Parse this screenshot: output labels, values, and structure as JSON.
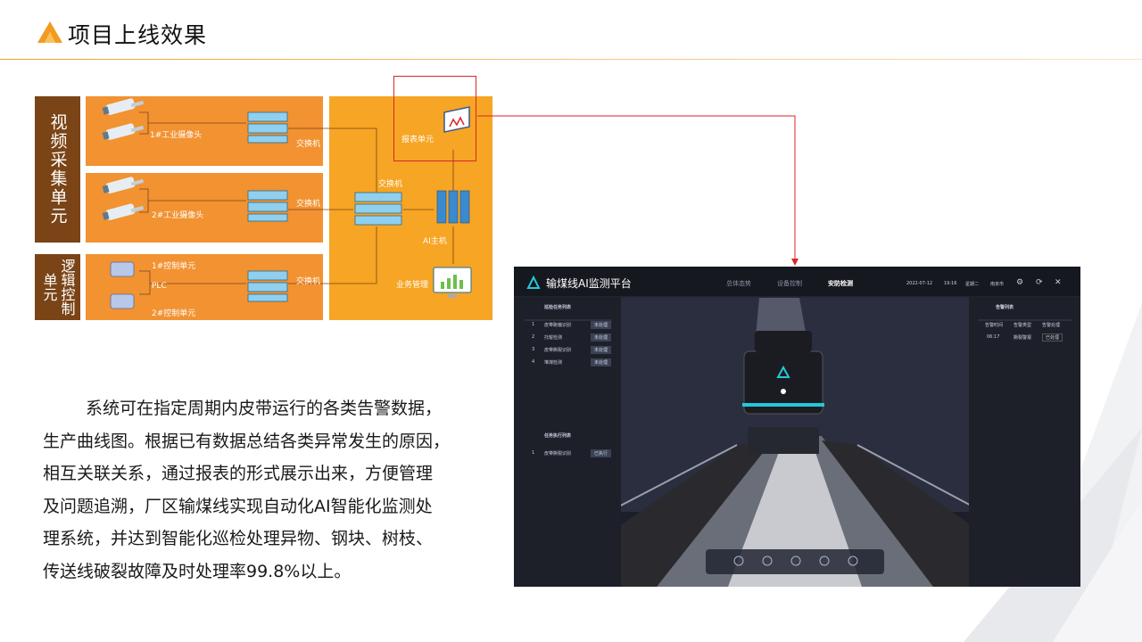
{
  "header": {
    "title": "项目上线效果"
  },
  "diagram": {
    "video_unit": "视频采集单元",
    "logic_unit": "逻辑控制单元",
    "camera1": "1#工业摄像头",
    "camera2": "2#工业摄像头",
    "switch1": "交换机",
    "switch2": "交换机",
    "switch3": "交换机",
    "switch_center": "交换机",
    "ai_host": "AI主机",
    "report_unit": "报表单元",
    "business": "业务管理",
    "ctrl1": "1#控制单元",
    "plc": "PLC",
    "ctrl2": "2#控制单元"
  },
  "body": {
    "line1": "系统可在指定周期内皮带运行的各类告警数据，",
    "line2": "生产曲线图。根据已有数据总结各类异常发生的原因，",
    "line3": "相互关联关系，通过报表的形式展示出来，方便管理",
    "line4": "及问题追溯，厂区输煤线实现自动化AI智能化监测处",
    "line5": "理系统，并达到智能化巡检处理异物、钢块、树枝、",
    "line6": "传送线破裂故障及时处理率99.8%以上。"
  },
  "platform": {
    "title": "输煤线AI监测平台",
    "tab1": "总体态势",
    "tab2": "设备控制",
    "tab3": "安防检测",
    "date": "2022-07-12",
    "time": "19:16",
    "weekday": "星期二",
    "location": "南京市",
    "left_panel_title": "巡检任务列表",
    "tasks": [
      {
        "no": "1",
        "name": "皮带跑偏识别",
        "btn": "未处理"
      },
      {
        "no": "2",
        "name": "托辊检测",
        "btn": "未处理"
      },
      {
        "no": "3",
        "name": "皮带撕裂识别",
        "btn": "未处理"
      },
      {
        "no": "4",
        "name": "堆煤检测",
        "btn": "未处理"
      }
    ],
    "exec_title": "任务执行列表",
    "exec": {
      "no": "1",
      "name": "皮带撕裂识别",
      "btn": "已执行"
    },
    "right_panel_title": "告警列表",
    "alarm_cols": [
      "告警时间",
      "告警类型",
      "告警处理"
    ],
    "alarm_row": {
      "time": "06:17",
      "type": "撕裂警报",
      "status": "已处理"
    }
  },
  "colors": {
    "orange": "#f4a030",
    "orange_dark": "#e8892a",
    "brown": "#7a4416",
    "red": "#d9262c",
    "accent": "#24c8d8"
  }
}
